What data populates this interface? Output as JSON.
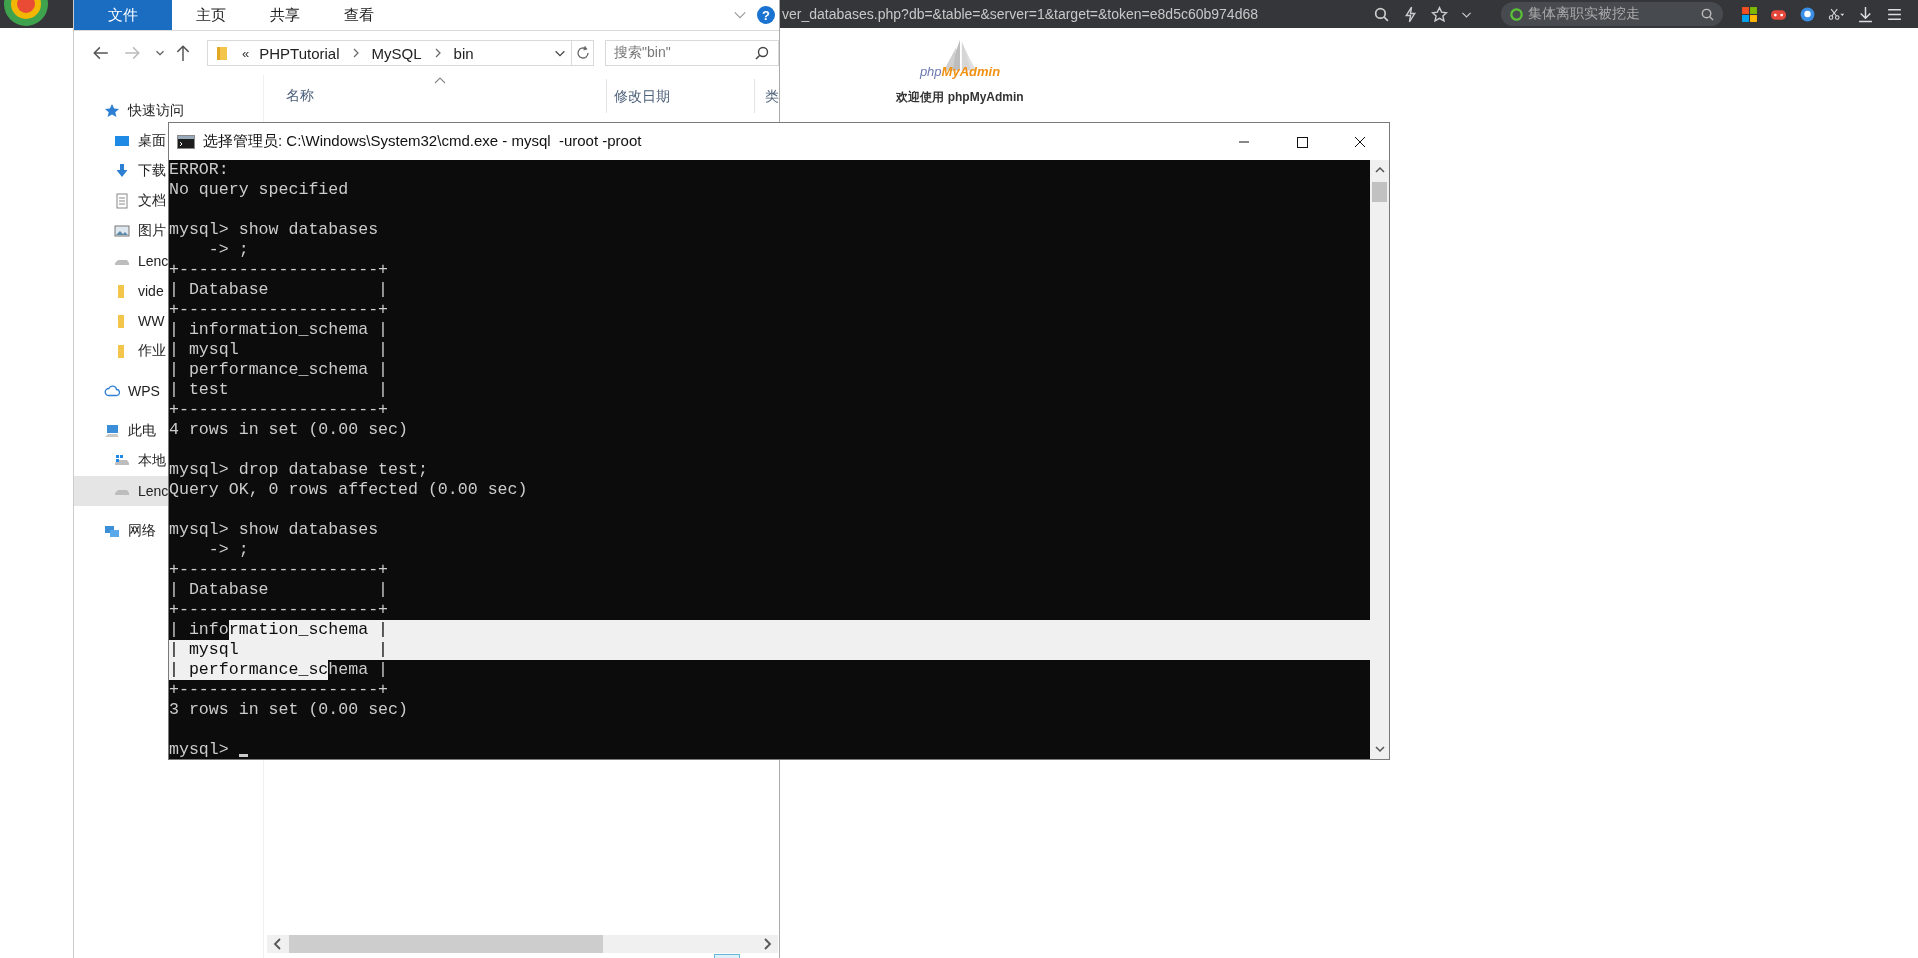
{
  "browser": {
    "address": "ver_databases.php?db=&table=&server=1&target=&token=e8d5c60b974d68",
    "search": {
      "placeholder": "集体离职实被挖走"
    },
    "page": {
      "logo_prefix": "php",
      "logo_name": "MyAdmin",
      "welcome": "欢迎使用 phpMyAdmin"
    }
  },
  "explorer": {
    "ribbon_tabs": [
      {
        "label": "文件",
        "selected": true
      },
      {
        "label": "主页",
        "selected": false
      },
      {
        "label": "共享",
        "selected": false
      },
      {
        "label": "查看",
        "selected": false
      }
    ],
    "help": "?",
    "address": {
      "overflow": "«",
      "crumbs": [
        "PHPTutorial",
        "MySQL",
        "bin"
      ]
    },
    "search": {
      "placeholder": "搜索\"bin\""
    },
    "columns": [
      "名称",
      "修改日期",
      "类"
    ],
    "nav": [
      {
        "label": "快速访问",
        "kind": "star",
        "selected": false,
        "children": [
          {
            "label": "桌面",
            "kind": "desktop",
            "selected": false
          },
          {
            "label": "下载",
            "kind": "download",
            "selected": false
          },
          {
            "label": "文档",
            "kind": "document",
            "selected": false
          },
          {
            "label": "图片",
            "kind": "picture",
            "selected": false
          },
          {
            "label": "Lenc",
            "kind": "drive",
            "selected": false
          },
          {
            "label": "vide",
            "kind": "folder",
            "selected": false
          },
          {
            "label": "WW",
            "kind": "folder",
            "selected": false
          },
          {
            "label": "作业",
            "kind": "folder",
            "selected": false
          }
        ]
      },
      {
        "label": "WPS",
        "kind": "cloud",
        "selected": false
      },
      {
        "label": "此电",
        "kind": "computer",
        "selected": false,
        "children": [
          {
            "label": "本地",
            "kind": "system-drive",
            "selected": false
          },
          {
            "label": "Lenc",
            "kind": "drive",
            "selected": true
          }
        ]
      },
      {
        "label": "网络",
        "kind": "network",
        "selected": false
      }
    ]
  },
  "cmd": {
    "title": "选择管理员: C:\\Windows\\System32\\cmd.exe - mysql  -uroot -proot",
    "blocks": [
      [
        "ERROR:",
        "No query specified"
      ],
      [
        "mysql> show databases",
        "    -> ;",
        "+--------------------+",
        "| Database           |",
        "+--------------------+",
        "| information_schema |",
        "| mysql              |",
        "| performance_schema |",
        "| test               |",
        "+--------------------+",
        "4 rows in set (0.00 sec)"
      ],
      [
        "mysql> drop database test;",
        "Query OK, 0 rows affected (0.00 sec)"
      ],
      [
        "mysql> show databases",
        "    -> ;",
        "+--------------------+",
        "| Database           |",
        "+--------------------+",
        {
          "segments": [
            {
              "text": "| info",
              "selected": false
            },
            {
              "text": "rmation_schema |",
              "selected": true
            }
          ]
        },
        {
          "segments": [
            {
              "text": "| mysql              |",
              "selected": true
            }
          ]
        },
        {
          "segments": [
            {
              "text": "| performance_sc",
              "selected": true
            },
            {
              "text": "hema |",
              "selected": false
            }
          ]
        },
        "+--------------------+",
        "3 rows in set (0.00 sec)"
      ],
      [
        {
          "segments": [
            {
              "text": "mysql>",
              "selected": false
            }
          ],
          "cursor": true
        }
      ]
    ]
  }
}
